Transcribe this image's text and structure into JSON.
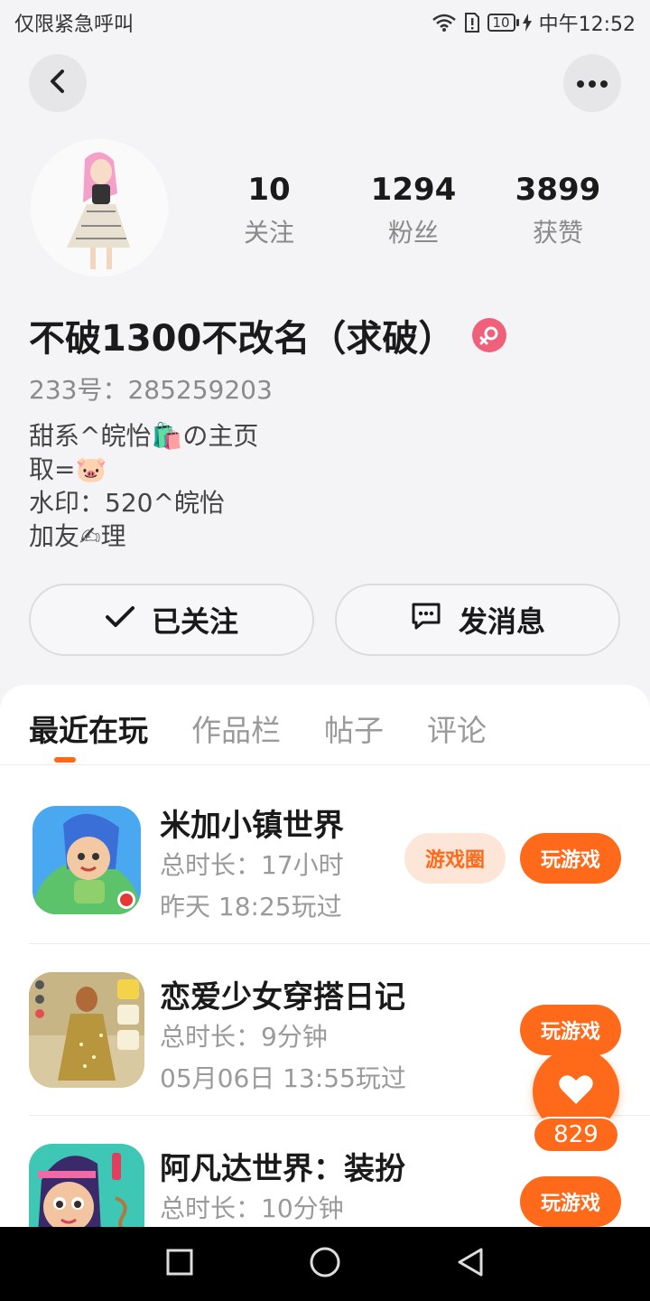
{
  "status_bar": {
    "carrier": "仅限紧急呼叫",
    "battery": "10",
    "time": "中午12:52"
  },
  "profile": {
    "stats": [
      {
        "value": "10",
        "label": "关注"
      },
      {
        "value": "1294",
        "label": "粉丝"
      },
      {
        "value": "3899",
        "label": "获赞"
      }
    ],
    "username": "不破1300不改名（求破）",
    "uid": "233号：285259203",
    "bio": [
      "甜系^皖怡🛍️の主页",
      "取=🐷",
      "水印：520^皖怡",
      "加友✍理"
    ],
    "follow_label": "已关注",
    "message_label": "发消息"
  },
  "tabs": [
    "最近在玩",
    "作品栏",
    "帖子",
    "评论"
  ],
  "games": [
    {
      "title": "米加小镇世界",
      "duration": "总时长：17小时",
      "last_played": "昨天 18:25玩过",
      "circle_label": "游戏圈",
      "play_label": "玩游戏"
    },
    {
      "title": "恋爱少女穿搭日记",
      "duration": "总时长：9分钟",
      "last_played": "05月06日 13:55玩过",
      "play_label": "玩游戏"
    },
    {
      "title": "阿凡达世界：装扮",
      "duration": "总时长：10分钟",
      "play_label": "玩游戏"
    }
  ],
  "like_count": "829",
  "colors": {
    "accent": "#ff6a1a",
    "gender": "#f0607a"
  }
}
